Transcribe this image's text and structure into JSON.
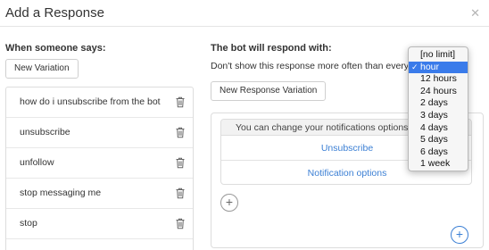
{
  "dialog": {
    "title": "Add a Response",
    "close_icon": "close-icon"
  },
  "triggers": {
    "heading": "When someone says:",
    "new_variation_label": "New Variation",
    "items": [
      {
        "text": "how do i unsubscribe from the bot",
        "icon": "trash-icon"
      },
      {
        "text": "unsubscribe",
        "icon": "trash-icon"
      },
      {
        "text": "unfollow",
        "icon": "trash-icon"
      },
      {
        "text": "stop messaging me",
        "icon": "trash-icon"
      },
      {
        "text": "stop",
        "icon": "trash-icon"
      }
    ]
  },
  "response": {
    "heading": "The bot will respond with:",
    "limit_label": "Don't show this response more often than every:",
    "new_response_variation_label": "New Response Variation",
    "card": {
      "text": "You can change your notifications options b",
      "buttons": [
        "Unsubscribe",
        "Notification options"
      ]
    },
    "add_button_icon": "plus-icon"
  },
  "frequency_dropdown": {
    "selected": "hour",
    "options": [
      "[no limit]",
      "hour",
      "12 hours",
      "24 hours",
      "2 days",
      "3 days",
      "4 days",
      "5 days",
      "6 days",
      "1 week"
    ]
  },
  "colors": {
    "link_blue": "#3b7fd4",
    "selection_blue": "#3a7bea",
    "border": "#dddddd"
  }
}
